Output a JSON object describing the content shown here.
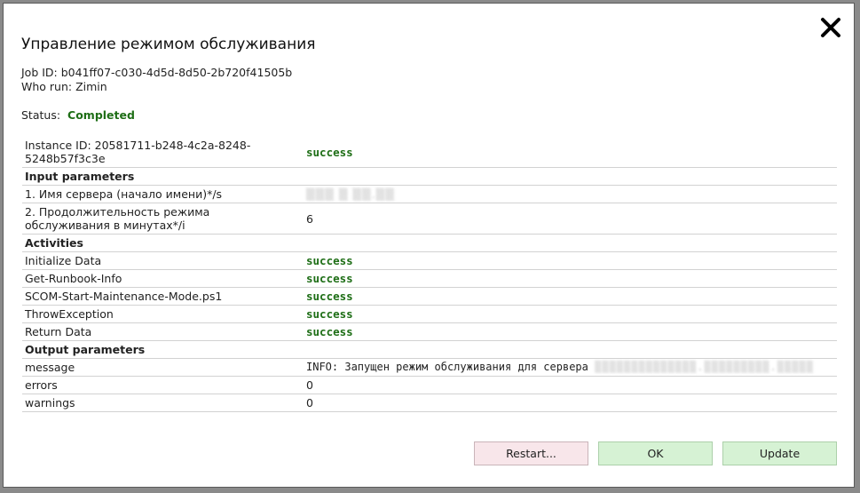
{
  "dialog": {
    "title": "Управление режимом обслуживания",
    "job_id": "Job ID: b041ff07-c030-4d5d-8d50-2b720f41505b",
    "who_run": "Who run: Zimin",
    "status_label": "Status:",
    "status_value": "Completed",
    "close_icon": "close-icon"
  },
  "grid": {
    "instance": {
      "label": "Instance ID: 20581711-b248-4c2a-8248-5248b57f3c3e",
      "value": "success"
    },
    "input_header": "Input parameters",
    "inputs": [
      {
        "label": "1. Имя сервера (начало имени)*/s",
        "value": ""
      },
      {
        "label": "2. Продолжительность режима обслуживания в минутах*/i",
        "value": "6"
      }
    ],
    "activities_header": "Activities",
    "activities": [
      {
        "label": "Initialize Data",
        "value": "success"
      },
      {
        "label": "Get-Runbook-Info",
        "value": "success"
      },
      {
        "label": "SCOM-Start-Maintenance-Mode.ps1",
        "value": "success"
      },
      {
        "label": "ThrowException",
        "value": "success"
      },
      {
        "label": "Return Data",
        "value": "success"
      }
    ],
    "output_header": "Output parameters",
    "outputs": [
      {
        "label": "message",
        "value": "INFO: Запущен режим обслуживания для сервера"
      },
      {
        "label": "errors",
        "value": "0"
      },
      {
        "label": "warnings",
        "value": "0"
      }
    ]
  },
  "buttons": {
    "restart": "Restart...",
    "ok": "OK",
    "update": "Update"
  },
  "colors": {
    "success": "#1e6e16",
    "restart_bg": "#f8e6ea",
    "ok_bg": "#d6f2d4"
  }
}
